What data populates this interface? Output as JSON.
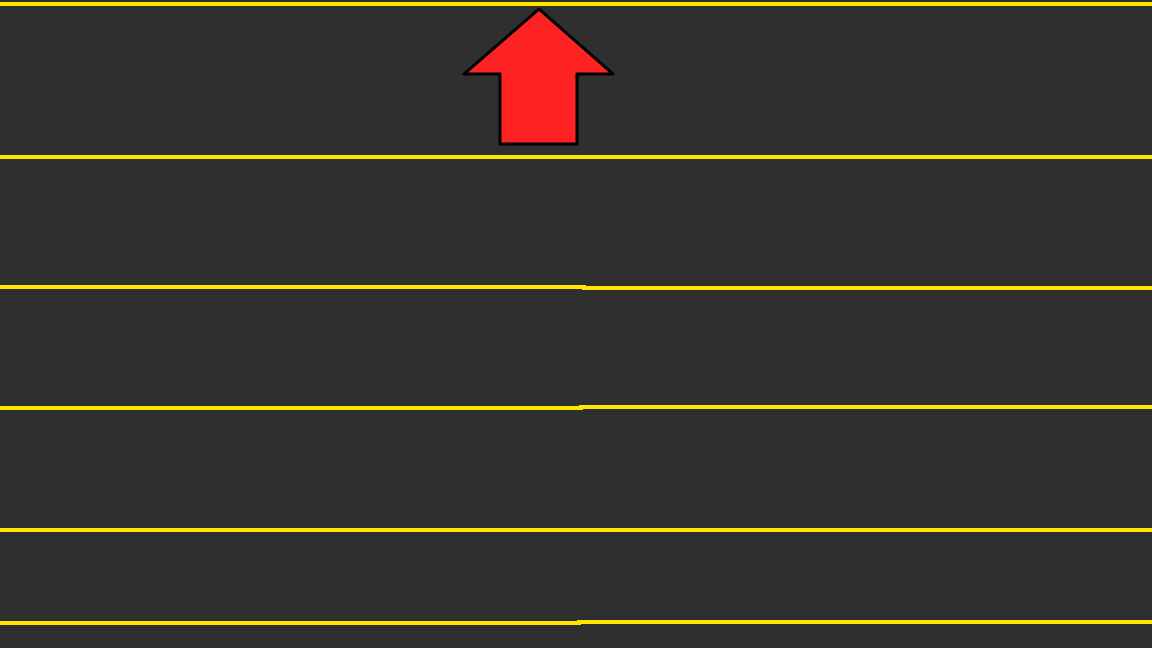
{
  "scene": {
    "background_color": "#2f2f2f",
    "lane_line_color": "#ffe600",
    "lane_count": 5,
    "arrow": {
      "icon": "up-arrow-icon",
      "direction": "up",
      "fill_color": "#ff2222",
      "outline_color": "#000000"
    }
  }
}
